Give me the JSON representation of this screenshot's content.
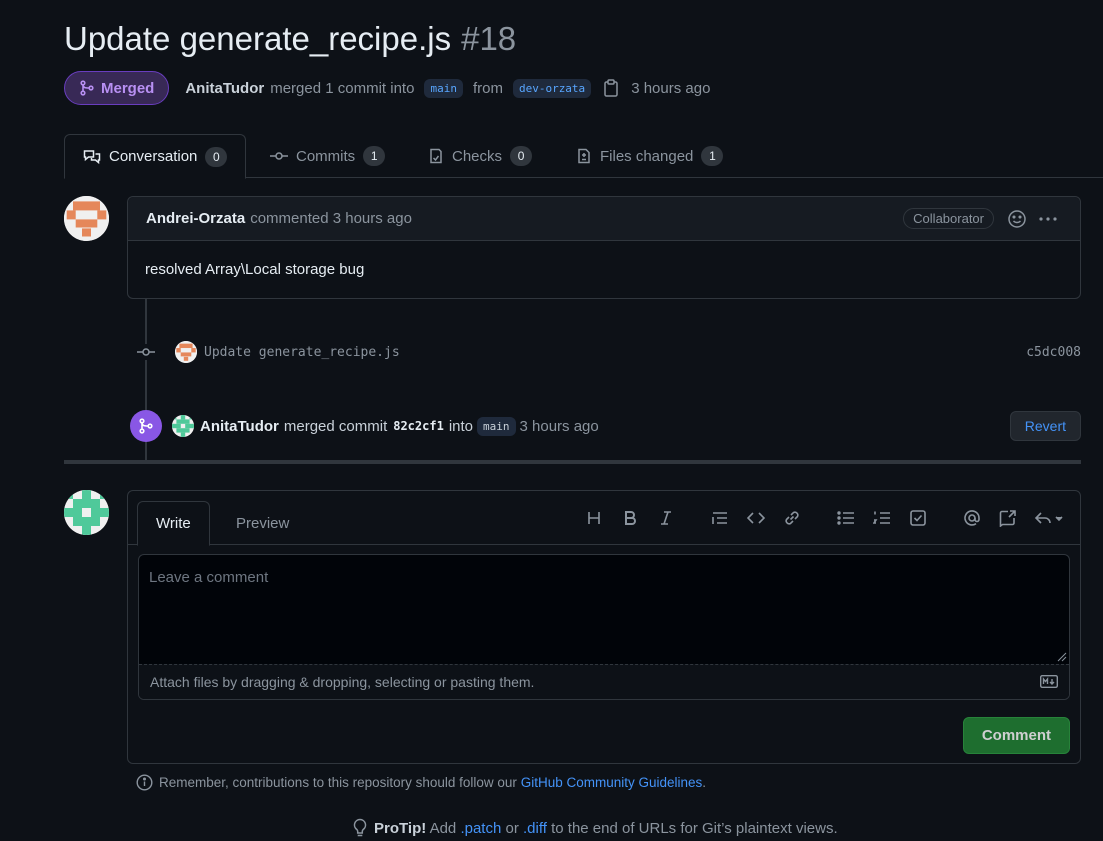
{
  "pr": {
    "title": "Update generate_recipe.js",
    "number": "#18",
    "status": "Merged",
    "author": "AnitaTudor",
    "merge_text": "merged 1 commit into",
    "base_branch": "main",
    "from_text": "from",
    "head_branch": "dev-orzata",
    "time": "3 hours ago"
  },
  "tabs": [
    {
      "label": "Conversation",
      "count": "0"
    },
    {
      "label": "Commits",
      "count": "1"
    },
    {
      "label": "Checks",
      "count": "0"
    },
    {
      "label": "Files changed",
      "count": "1"
    }
  ],
  "comment": {
    "author": "Andrei-Orzata",
    "action": "commented 3 hours ago",
    "role": "Collaborator",
    "body": "resolved Array\\Local storage bug"
  },
  "commit": {
    "message": "Update generate_recipe.js",
    "sha": "c5dc008"
  },
  "merge_event": {
    "user": "AnitaTudor",
    "text1": "merged commit",
    "sha": "82c2cf1",
    "text2": "into",
    "branch": "main",
    "time": "3 hours ago",
    "revert_label": "Revert"
  },
  "editor": {
    "tab_write": "Write",
    "tab_preview": "Preview",
    "placeholder": "Leave a comment",
    "attach_text": "Attach files by dragging & dropping, selecting or pasting them.",
    "submit_label": "Comment"
  },
  "guidelines": {
    "prefix": "Remember, contributions to this repository should follow our",
    "link": "GitHub Community Guidelines",
    "suffix": "."
  },
  "protip": {
    "label": "ProTip!",
    "t1": "Add",
    "patch": ".patch",
    "t2": "or",
    "diff": ".diff",
    "t3": "to the end of URLs for Git’s plaintext views."
  },
  "colors": {
    "background": "#0d1117",
    "merged_purple": "#8957e5",
    "link_blue": "#4493f8",
    "comment_green": "#238636"
  }
}
